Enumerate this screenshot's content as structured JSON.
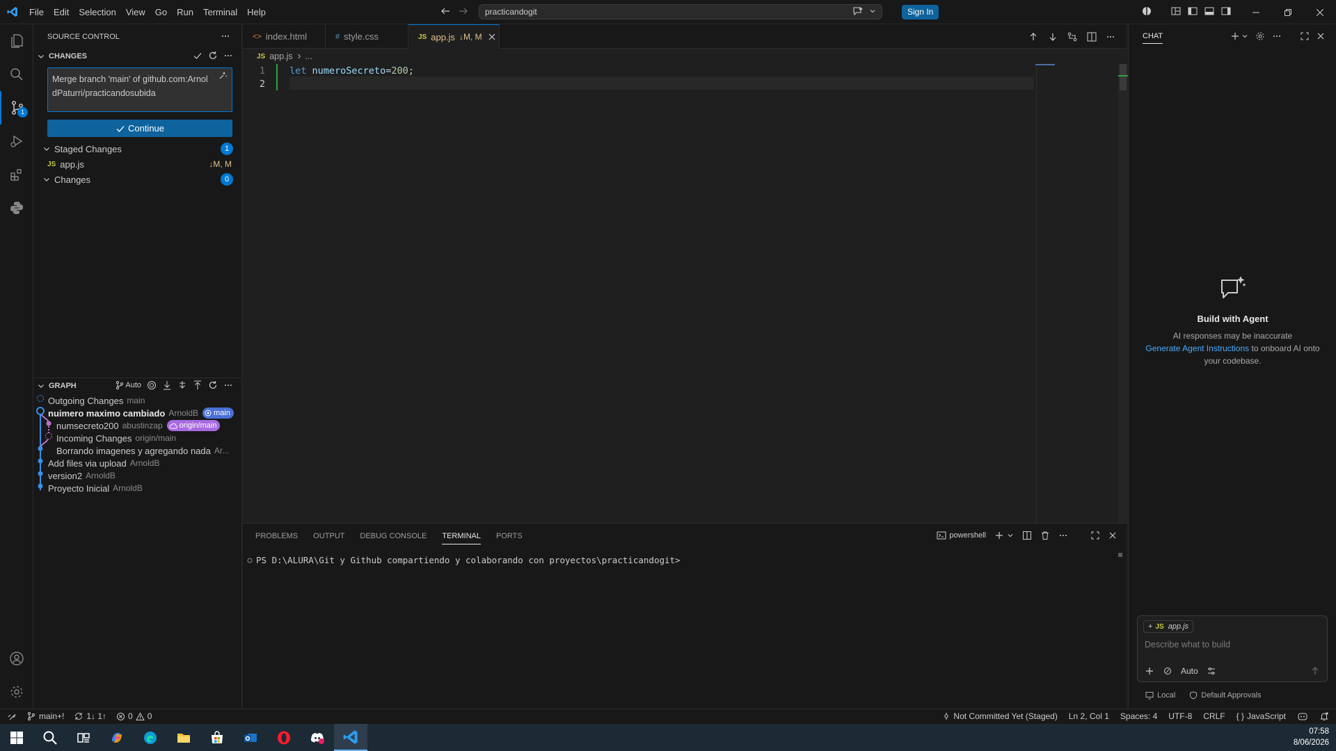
{
  "titlebar": {
    "menu": [
      "File",
      "Edit",
      "Selection",
      "View",
      "Go",
      "Run",
      "Terminal",
      "Help"
    ],
    "search_text": "practicandogit",
    "signin_label": "Sign In"
  },
  "activitybar": {
    "scm_badge": "1"
  },
  "sidebar": {
    "title": "SOURCE CONTROL",
    "changes_header": "CHANGES",
    "commit_message": "Merge branch 'main' of github.com:ArnoldPaturri/practicandosubida",
    "continue_label": "Continue",
    "staged_label": "Staged Changes",
    "staged_count": "1",
    "staged_file": "app.js",
    "staged_file_status": "↓M, M",
    "changes_label": "Changes",
    "changes_count": "0",
    "graph_header": "GRAPH",
    "graph_auto": "Auto",
    "graph": [
      {
        "message": "Outgoing Changes",
        "author": "main"
      },
      {
        "message": "nuimero maximo cambiado",
        "author": "ArnoldB",
        "ref": "main"
      },
      {
        "message": "numsecreto200",
        "author": "abustinzap",
        "ref": "origin/main"
      },
      {
        "message": "Incoming Changes",
        "author": "origin/main"
      },
      {
        "message": "Borrando imagenes y agregando nada",
        "author": "Ar..."
      },
      {
        "message": "Add files via upload",
        "author": "ArnoldB"
      },
      {
        "message": "version2",
        "author": "ArnoldB"
      },
      {
        "message": "Proyecto Inicial",
        "author": "ArnoldB"
      }
    ]
  },
  "tabs": [
    {
      "label": "index.html",
      "icon": "<>"
    },
    {
      "label": "style.css",
      "icon": "#"
    },
    {
      "label": "app.js",
      "icon": "JS",
      "status": "↓M, M"
    }
  ],
  "breadcrumb": {
    "file": "app.js",
    "rest": "..."
  },
  "editor": {
    "lines": [
      {
        "num": "1",
        "kw": "let",
        "var": "numeroSecreto",
        "op": "=",
        "num_val": "200",
        "end": ";"
      },
      {
        "num": "2"
      }
    ]
  },
  "panel": {
    "tabs": [
      "PROBLEMS",
      "OUTPUT",
      "DEBUG CONSOLE",
      "TERMINAL",
      "PORTS"
    ],
    "active_tab": "TERMINAL",
    "shell": "powershell",
    "prompt": "PS D:\\ALURA\\Git y Github compartiendo y  colaborando con proyectos\\practicandogit>"
  },
  "chat": {
    "title": "CHAT",
    "empty_title": "Build with Agent",
    "empty_desc1": "AI responses may be inaccurate",
    "link": "Generate Agent Instructions",
    "empty_desc2": "to onboard AI onto your codebase.",
    "attachment": "app.js",
    "placeholder": "Describe what to build",
    "mode": "Auto",
    "foot_local": "Local",
    "foot_approvals": "Default Approvals"
  },
  "statusbar": {
    "branch": "main+!",
    "sync": "1↓ 1↑",
    "errors": "0",
    "warnings": "0",
    "blame": "Not Committed Yet (Staged)",
    "position": "Ln 2, Col 1",
    "spaces": "Spaces: 4",
    "encoding": "UTF-8",
    "eol": "CRLF",
    "language": "JavaScript"
  },
  "taskbar": {
    "time": "07:58",
    "date": "8/06/2026"
  },
  "colors": {
    "accent": "#0078d4",
    "modified": "#e2c08d",
    "pill_main": "#4a6fd6",
    "pill_origin": "#a86ae0"
  }
}
